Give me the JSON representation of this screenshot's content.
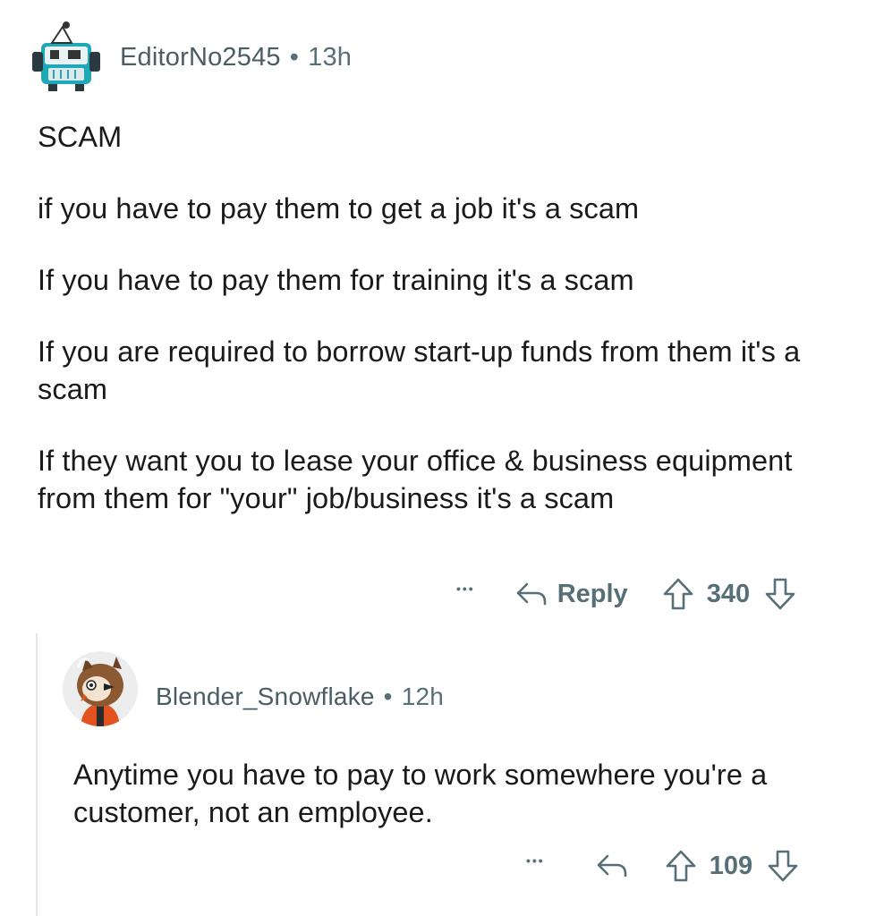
{
  "comments": [
    {
      "username": "EditorNo2545",
      "separator": "•",
      "age": "13h",
      "avatar_icon": "snoo-robot-avatar-icon",
      "paragraphs": [
        "SCAM",
        "if you have to pay them to get a job it's a scam",
        "If you have to pay them for training it's a scam",
        "If you are required to borrow start-up funds from them it's a scam",
        "If they want you to lease your office & business equipment from them for \"your\" job/business it's a scam"
      ],
      "actions": {
        "more": "•••",
        "reply_label": "Reply",
        "score": "340"
      }
    },
    {
      "username": "Blender_Snowflake",
      "separator": "•",
      "age": "12h",
      "avatar_icon": "snoo-owl-avatar-icon",
      "paragraphs": [
        "Anytime you have to pay to work somewhere you're a customer, not an employee."
      ],
      "actions": {
        "more": "•••",
        "score": "109"
      }
    }
  ],
  "colors": {
    "meta_text": "#576f76",
    "body_text": "#1a1a1b",
    "thread_line": "#e3e6e8"
  }
}
